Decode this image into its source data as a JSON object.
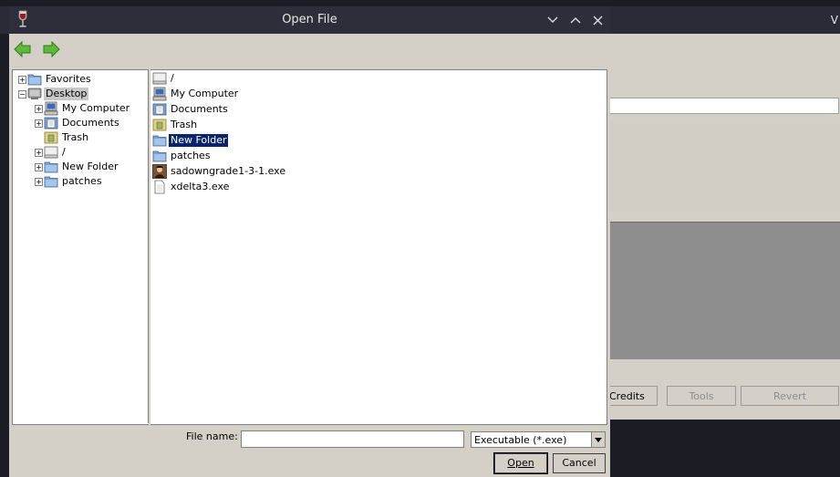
{
  "background_app": {
    "title_fragment": "V",
    "buttons": {
      "credits": "Credits",
      "tools": "Tools",
      "revert": "Revert"
    }
  },
  "dialog": {
    "title": "Open File",
    "icons": {
      "app": "wine-glass-icon",
      "minimize": "chevron-down-icon",
      "maximize": "chevron-up-icon",
      "close": "close-icon",
      "back": "arrow-left-icon",
      "forward": "arrow-right-icon"
    }
  },
  "tree": [
    {
      "label": "Favorites",
      "icon": "folder-icon",
      "expander": "+"
    },
    {
      "label": "Desktop",
      "icon": "desktop-icon",
      "expander": "−",
      "selected": true
    },
    {
      "label": "My Computer",
      "icon": "computer-icon",
      "expander": "+"
    },
    {
      "label": "Documents",
      "icon": "documents-icon",
      "expander": "+"
    },
    {
      "label": "Trash",
      "icon": "trash-icon",
      "expander": ""
    },
    {
      "label": "/",
      "icon": "drive-icon",
      "expander": "+"
    },
    {
      "label": "New Folder",
      "icon": "folder-icon",
      "expander": "+"
    },
    {
      "label": "patches",
      "icon": "folder-icon",
      "expander": "+"
    }
  ],
  "files": [
    {
      "label": "/",
      "icon": "drive-icon"
    },
    {
      "label": "My Computer",
      "icon": "computer-icon"
    },
    {
      "label": "Documents",
      "icon": "documents-icon"
    },
    {
      "label": "Trash",
      "icon": "trash-icon"
    },
    {
      "label": "New Folder",
      "icon": "folder-icon",
      "selected": true
    },
    {
      "label": "patches",
      "icon": "folder-icon"
    },
    {
      "label": "sadowngrade1-3-1.exe",
      "icon": "exe-app-icon"
    },
    {
      "label": "xdelta3.exe",
      "icon": "file-icon"
    }
  ],
  "form": {
    "filename_label": "File name:",
    "filename_value": "",
    "filetype_selected": "Executable (*.exe)",
    "open_label": "Open",
    "cancel_label": "Cancel"
  },
  "colors": {
    "selection": "#0a246a",
    "dialog_bg": "#d4d0c8",
    "titlebar": "#2e2e3a",
    "nav_arrow": "#5fb93a"
  }
}
